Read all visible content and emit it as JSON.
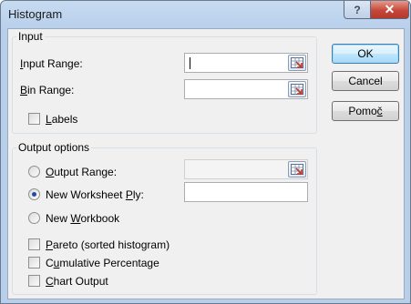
{
  "window": {
    "title": "Histogram",
    "help_glyph": "?",
    "close_glyph": "✕"
  },
  "input_group": {
    "label": "Input",
    "input_range": {
      "label_pre": "",
      "label_key": "I",
      "label_post": "nput Range:",
      "value": ""
    },
    "bin_range": {
      "label_pre": "",
      "label_key": "B",
      "label_post": "in Range:",
      "value": ""
    },
    "labels": {
      "label_pre": "",
      "label_key": "L",
      "label_post": "abels",
      "checked": false
    }
  },
  "output_group": {
    "label": "Output options",
    "output_range": {
      "label_pre": "",
      "label_key": "O",
      "label_post": "utput Range:",
      "value": "",
      "selected": false
    },
    "new_worksheet_ply": {
      "label_pre": "New Worksheet ",
      "label_key": "P",
      "label_post": "ly:",
      "value": "",
      "selected": true
    },
    "new_workbook": {
      "label_pre": "New ",
      "label_key": "W",
      "label_post": "orkbook",
      "selected": false
    },
    "pareto": {
      "label_pre": "",
      "label_key": "P",
      "label_post": "areto (sorted histogram)",
      "checked": false
    },
    "cumulative": {
      "label_pre": "C",
      "label_key": "u",
      "label_post": "mulative Percentage",
      "checked": false
    },
    "chart_output": {
      "label_pre": "",
      "label_key": "C",
      "label_post": "hart Output",
      "checked": false
    }
  },
  "buttons": {
    "ok": {
      "label_pre": "OK",
      "label_key": "",
      "label_post": ""
    },
    "cancel": {
      "label_pre": "Cancel",
      "label_key": "",
      "label_post": ""
    },
    "help": {
      "label_pre": "Pomo",
      "label_key": "č",
      "label_post": ""
    }
  },
  "icons": {
    "range_selector": "collapse-dialog-icon",
    "accent": "#c0392b"
  }
}
